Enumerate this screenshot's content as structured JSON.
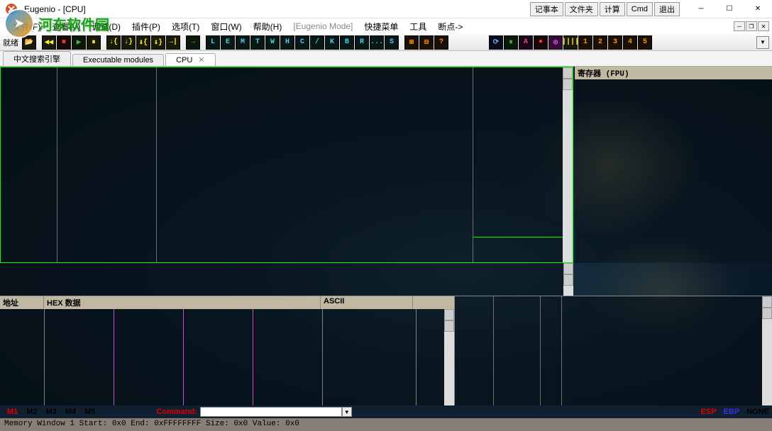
{
  "title": "Eugenio - [CPU]",
  "watermark": "河东软件园",
  "ext_buttons": [
    "记事本",
    "文件夹",
    "计算",
    "Cmd",
    "退出"
  ],
  "menu": {
    "file": "文件(F)",
    "view": "查看(V)",
    "debug": "调试(D)",
    "plugin": "插件(P)",
    "option": "选项(T)",
    "window": "窗口(W)",
    "help": "帮助(H)",
    "mode": "[Eugenio Mode]",
    "quick": "快捷菜单",
    "tools": "工具",
    "bp": "断点->"
  },
  "toolbar_label": "就绪",
  "toolbar_letters": [
    "L",
    "E",
    "M",
    "T",
    "W",
    "H",
    "C",
    "/",
    "K",
    "B",
    "R",
    "...",
    "S"
  ],
  "toolbar_nums": [
    "1",
    "2",
    "3",
    "4",
    "5"
  ],
  "tabs": [
    {
      "label": "中文搜索引擎",
      "active": false,
      "closable": false
    },
    {
      "label": "Executable modules",
      "active": false,
      "closable": false
    },
    {
      "label": "CPU",
      "active": true,
      "closable": true
    }
  ],
  "registers_title": "寄存器 (FPU)",
  "hex_headers": {
    "addr": "地址",
    "hex": "HEX 数据",
    "ascii": "ASCII"
  },
  "cmd": {
    "m_labels": [
      "M1",
      "M2",
      "M3",
      "M4",
      "M5"
    ],
    "label": "Command:",
    "value": "",
    "regs": {
      "esp": "ESP",
      "ebp": "EBP",
      "none": "NONE"
    }
  },
  "status": "Memory Window 1 Start: 0x0 End: 0xFFFFFFFF Size: 0x0 Value: 0x0"
}
